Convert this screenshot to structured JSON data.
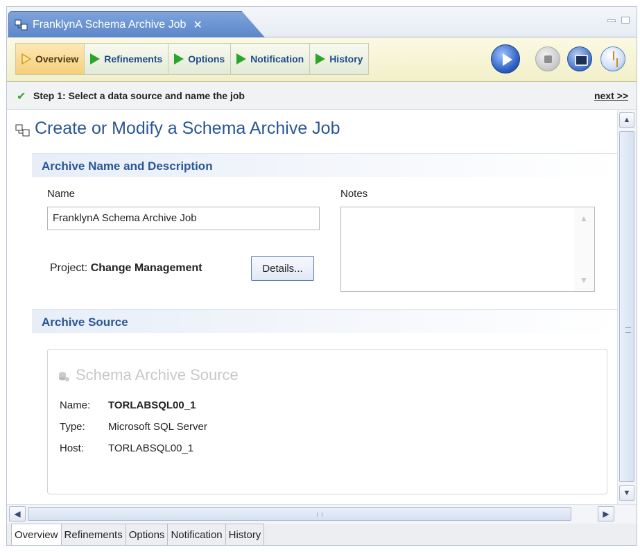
{
  "window": {
    "title": "FranklynA Schema Archive Job",
    "close_glyph": "✕"
  },
  "nav_tabs": [
    {
      "label": "Overview",
      "active": true
    },
    {
      "label": "Refinements",
      "active": false
    },
    {
      "label": "Options",
      "active": false
    },
    {
      "label": "Notification",
      "active": false
    },
    {
      "label": "History",
      "active": false
    }
  ],
  "toolbar": {
    "icons": [
      "run-icon",
      "stop-icon",
      "console-icon",
      "schedule-icon"
    ]
  },
  "step": {
    "check": "✔",
    "text": "Step 1: Select a data source and name the job",
    "next": "next >>"
  },
  "page": {
    "title": "Create or Modify a Schema Archive Job"
  },
  "archive_name": {
    "section_title": "Archive Name and Description",
    "name_label": "Name",
    "name_value": "FranklynA Schema Archive Job",
    "notes_label": "Notes",
    "notes_value": "",
    "project_label": "Project:",
    "project_value": "Change Management",
    "details_button": "Details..."
  },
  "archive_source": {
    "section_title": "Archive Source",
    "box_title": "Schema Archive Source",
    "rows": [
      {
        "key": "Name:",
        "value": "TORLABSQL00_1"
      },
      {
        "key": "Type:",
        "value": "Microsoft SQL Server"
      },
      {
        "key": "Host:",
        "value": "TORLABSQL00_1"
      }
    ]
  },
  "bottom_tabs": [
    {
      "label": "Overview",
      "active": true
    },
    {
      "label": "Refinements",
      "active": false
    },
    {
      "label": "Options",
      "active": false
    },
    {
      "label": "Notification",
      "active": false
    },
    {
      "label": "History",
      "active": false
    }
  ],
  "colors": {
    "accent_blue": "#2a5695",
    "tab_active": "#f5cf7a",
    "play_green": "#2aa52a"
  }
}
